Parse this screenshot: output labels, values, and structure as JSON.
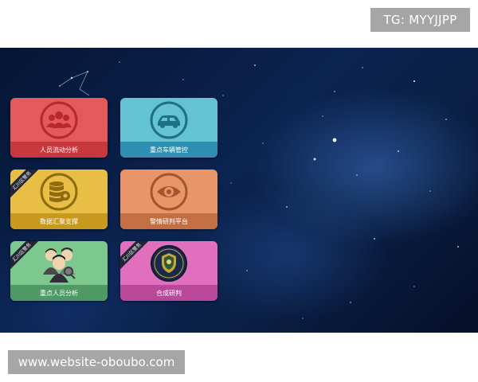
{
  "watermark": {
    "top_right": "TG: MYYJJPP",
    "bottom_left": "www.website-oboubo.com"
  },
  "tiles": [
    {
      "label": "人员流动分析",
      "icon": "people-group-icon",
      "color": "#e45a5a",
      "footer_color": "#c9383c",
      "ribbon": ""
    },
    {
      "label": "重点车辆管控",
      "icon": "car-icon",
      "color": "#63c3d3",
      "footer_color": "#2f8fb0",
      "ribbon": ""
    },
    {
      "label": "数据汇聚支撑",
      "icon": "database-icon",
      "color": "#e8be45",
      "footer_color": "#c79a1f",
      "ribbon": "汇川区警务"
    },
    {
      "label": "警情研判平台",
      "icon": "eye-icon",
      "color": "#e8956a",
      "footer_color": "#c46f43",
      "ribbon": ""
    },
    {
      "label": "重点人员分析",
      "icon": "suspects-photo-icon",
      "color": "#7cc88f",
      "footer_color": "#4f9a64",
      "ribbon": "汇川区警务"
    },
    {
      "label": "合成研判",
      "icon": "police-badge-icon",
      "color": "#e06fbd",
      "footer_color": "#b9479a",
      "ribbon": "汇川区警务"
    }
  ]
}
